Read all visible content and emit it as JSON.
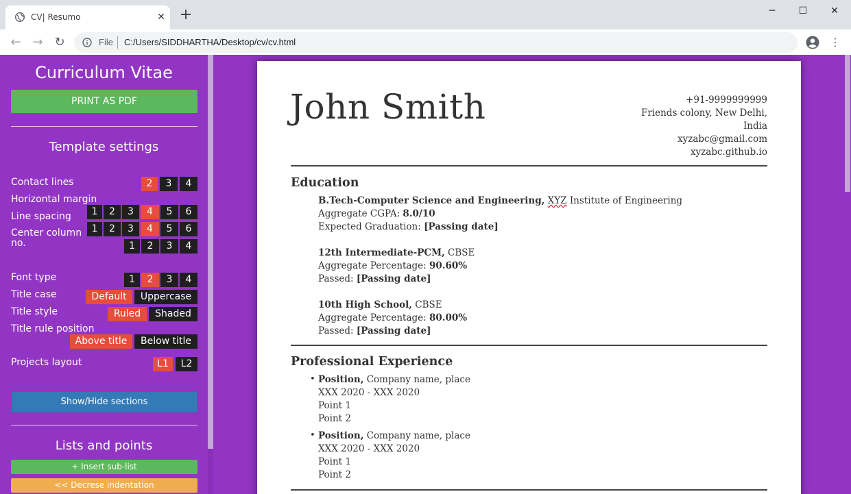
{
  "browser": {
    "tab_title": "CV| Resumo",
    "new_tab": "+",
    "file_label": "File",
    "url": "C:/Users/SIDDHARTHA/Desktop/cv/cv.html"
  },
  "sidebar": {
    "title": "Curriculum Vitae",
    "print_button": "PRINT AS PDF",
    "template_settings": "Template settings",
    "options": {
      "contact_lines": {
        "label": "Contact lines",
        "choices": [
          "2",
          "3",
          "4"
        ],
        "selected": "2"
      },
      "horizontal_margin": {
        "label": "Horizontal margin",
        "choices": [
          "1",
          "2",
          "3",
          "4",
          "5",
          "6"
        ],
        "selected": "4"
      },
      "line_spacing": {
        "label": "Line spacing",
        "choices": [
          "1",
          "2",
          "3",
          "4",
          "5",
          "6"
        ],
        "selected": "4"
      },
      "center_column": {
        "label": "Center column no.",
        "choices": [
          "1",
          "2",
          "3",
          "4"
        ],
        "selected": ""
      },
      "font_type": {
        "label": "Font type",
        "choices": [
          "1",
          "2",
          "3",
          "4"
        ],
        "selected": "2"
      },
      "title_case": {
        "label": "Title case",
        "choices": [
          "Default",
          "Uppercase"
        ],
        "selected": "Default"
      },
      "title_style": {
        "label": "Title style",
        "choices": [
          "Ruled",
          "Shaded"
        ],
        "selected": "Ruled"
      },
      "title_rule_position": {
        "label": "Title rule position",
        "choices": [
          "Above title",
          "Below title"
        ],
        "selected": "Above title"
      },
      "projects_layout": {
        "label": "Projects layout",
        "choices": [
          "L1",
          "L2"
        ],
        "selected": "L1"
      }
    },
    "show_hide_button": "Show/Hide sections",
    "lists_heading": "Lists and points",
    "insert_sublist": "+ Insert sub-list",
    "decrease_indent": "<< Decrese indentation"
  },
  "cv": {
    "name": "John Smith",
    "contact": [
      "+91-9999999999",
      "Friends colony, New Delhi,",
      "India",
      "xyzabc@gmail.com",
      "xyzabc.github.io"
    ],
    "education_title": "Education",
    "education": [
      {
        "degree": "B.Tech-Computer Science and Engineering,",
        "inst_abbr": "XYZ",
        "inst_rest": " Institute of Engineering",
        "line2_label": "Aggregate CGPA: ",
        "line2_value": "8.0/10",
        "line3_label": "Expected Graduation: ",
        "line3_value": "[Passing date]"
      },
      {
        "degree": "12th Intermediate-PCM,",
        "inst": " CBSE",
        "line2_label": "Aggregate Percentage: ",
        "line2_value": "90.60%",
        "line3_label": "Passed: ",
        "line3_value": "[Passing date]"
      },
      {
        "degree": "10th High School,",
        "inst": " CBSE",
        "line2_label": "Aggregate Percentage: ",
        "line2_value": "80.00%",
        "line3_label": "Passed: ",
        "line3_value": "[Passing date]"
      }
    ],
    "experience_title": "Professional Experience",
    "experience": [
      {
        "position": "Position,",
        "company": " Company name, place",
        "dates": "XXX 2020 - XXX 2020",
        "points": [
          "Point 1",
          "Point 2"
        ]
      },
      {
        "position": "Position,",
        "company": " Company name, place",
        "dates": "XXX 2020 - XXX 2020",
        "points": [
          "Point 1",
          "Point 2"
        ]
      }
    ]
  },
  "colors": {
    "sidebar_bg": "#9335c4",
    "selected_chip": "#e74c3c",
    "chip": "#1f1f1f",
    "print_btn": "#5cb85c",
    "show_hide_btn": "#337ab7",
    "decrease_btn": "#f0ad4e"
  }
}
